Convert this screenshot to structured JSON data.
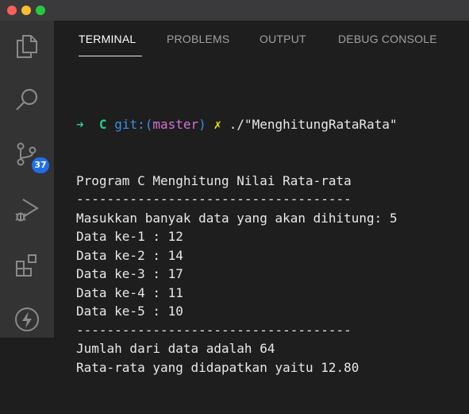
{
  "window": {
    "traffic_lights": [
      "close",
      "minimize",
      "maximize"
    ]
  },
  "activity_bar": {
    "items": [
      {
        "icon": "explorer-icon"
      },
      {
        "icon": "search-icon"
      },
      {
        "icon": "source-control-icon",
        "badge": "37"
      },
      {
        "icon": "run-debug-icon"
      },
      {
        "icon": "extensions-icon"
      },
      {
        "icon": "lightning-icon"
      }
    ]
  },
  "panel": {
    "tabs": [
      {
        "label": "TERMINAL",
        "active": true
      },
      {
        "label": "PROBLEMS",
        "active": false
      },
      {
        "label": "OUTPUT",
        "active": false
      },
      {
        "label": "DEBUG CONSOLE",
        "active": false
      }
    ]
  },
  "terminal": {
    "prompt": {
      "arrow": "➜",
      "dir": "C",
      "git_prefix": "git:(",
      "branch": "master",
      "git_suffix": ")",
      "dirty_mark": "✗",
      "command": "./\"MenghitungRataRata\""
    },
    "lines": [
      "Program C Menghitung Nilai Rata-rata",
      "------------------------------------",
      "Masukkan banyak data yang akan dihitung: 5",
      "Data ke-1 : 12",
      "Data ke-2 : 14",
      "Data ke-3 : 17",
      "Data ke-4 : 11",
      "Data ke-5 : 10",
      "------------------------------------",
      "Jumlah dari data adalah 64",
      "Rata-rata yang didapatkan yaitu 12.80"
    ]
  },
  "colors": {
    "background": "#1e1e1e",
    "activity_bar": "#333333",
    "prompt_arrow": "#23d18b",
    "git_label": "#3b8eea",
    "branch": "#d670d6",
    "dirty_mark": "#e5e510",
    "badge": "#1f6feb"
  }
}
